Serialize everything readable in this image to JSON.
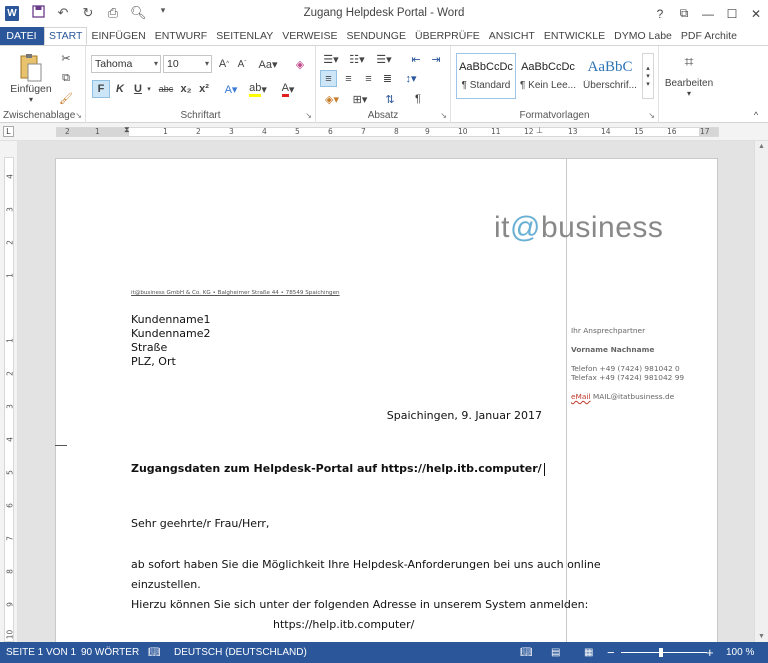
{
  "window": {
    "title": "Zugang Helpdesk Portal - Word",
    "app_icon": "W",
    "help": "?",
    "controls": [
      "restore",
      "minimize",
      "maximize",
      "close"
    ]
  },
  "qat": {
    "icons": [
      "save-icon",
      "undo-icon",
      "redo-icon",
      "print-icon",
      "preview-icon",
      "customize-icon"
    ]
  },
  "tabs": [
    "DATEI",
    "START",
    "EINFÜGEN",
    "ENTWURF",
    "SEITENLAY",
    "VERWEISE",
    "SENDUNGE",
    "ÜBERPRÜFE",
    "ANSICHT",
    "ENTWICKLE",
    "DYMO Labe",
    "PDF Archite"
  ],
  "ribbon": {
    "clipboard": {
      "label": "Zwischenablage",
      "paste": "Einfügen"
    },
    "font": {
      "label": "Schriftart",
      "name": "Tahoma",
      "size": "10",
      "bold": "F",
      "italic": "K",
      "underline": "U",
      "strike": "abc",
      "sub": "x₂",
      "sup": "x²"
    },
    "paragraph": {
      "label": "Absatz"
    },
    "styles": {
      "label": "Formatvorlagen",
      "items": [
        {
          "sample": "AaBbCcDc",
          "name": "¶ Standard"
        },
        {
          "sample": "AaBbCcDc",
          "name": "¶ Kein Lee..."
        },
        {
          "sample": "AaBbC",
          "name": "Überschrif..."
        }
      ]
    },
    "edit": {
      "label": "Bearbeiten"
    }
  },
  "ruler": {
    "h": [
      "2",
      "1",
      "1",
      "2",
      "3",
      "4",
      "5",
      "6",
      "7",
      "8",
      "9",
      "10",
      "11",
      "12",
      "13",
      "14",
      "15",
      "16",
      "17",
      "18"
    ],
    "v": [
      "4",
      "3",
      "2",
      "1",
      "1",
      "2",
      "3",
      "4",
      "5",
      "6",
      "7",
      "8",
      "9",
      "10"
    ]
  },
  "document": {
    "logo_left": "it",
    "logo_at": "@",
    "logo_right": "business",
    "sender_line": "it@business GmbH & Co. KG • Balgheimer Straße 44 • 78549 Spaichingen",
    "address": [
      "Kundenname1",
      "Kundenname2",
      "Straße",
      "PLZ, Ort"
    ],
    "date": "Spaichingen, 9. Januar 2017",
    "subject": "Zugangsdaten zum Helpdesk-Portal auf https://help.itb.computer/",
    "salutation": "Sehr geehrte/r Frau/Herr,",
    "body1": "ab sofort haben Sie die Möglichkeit Ihre Helpdesk-Anforderungen bei uns auch online",
    "body2": "einzustellen.",
    "body3": "Hierzu können Sie sich unter der folgenden Adresse in unserem System anmelden:",
    "link": "https://help.itb.computer/",
    "contact": {
      "heading": "Ihr Ansprechpartner",
      "name": "Vorname Nachname",
      "phone": "Telefon +49 (7424) 981042 0",
      "fax": "Telefax +49 (7424) 981042 99",
      "mail_label": "eMail",
      "mail": "MAIL@itatbusiness.de"
    }
  },
  "status": {
    "page": "SEITE 1 VON 1",
    "words": "90 WÖRTER",
    "language": "DEUTSCH (DEUTSCHLAND)",
    "zoom": "100 %",
    "zoom_percent": 100
  }
}
